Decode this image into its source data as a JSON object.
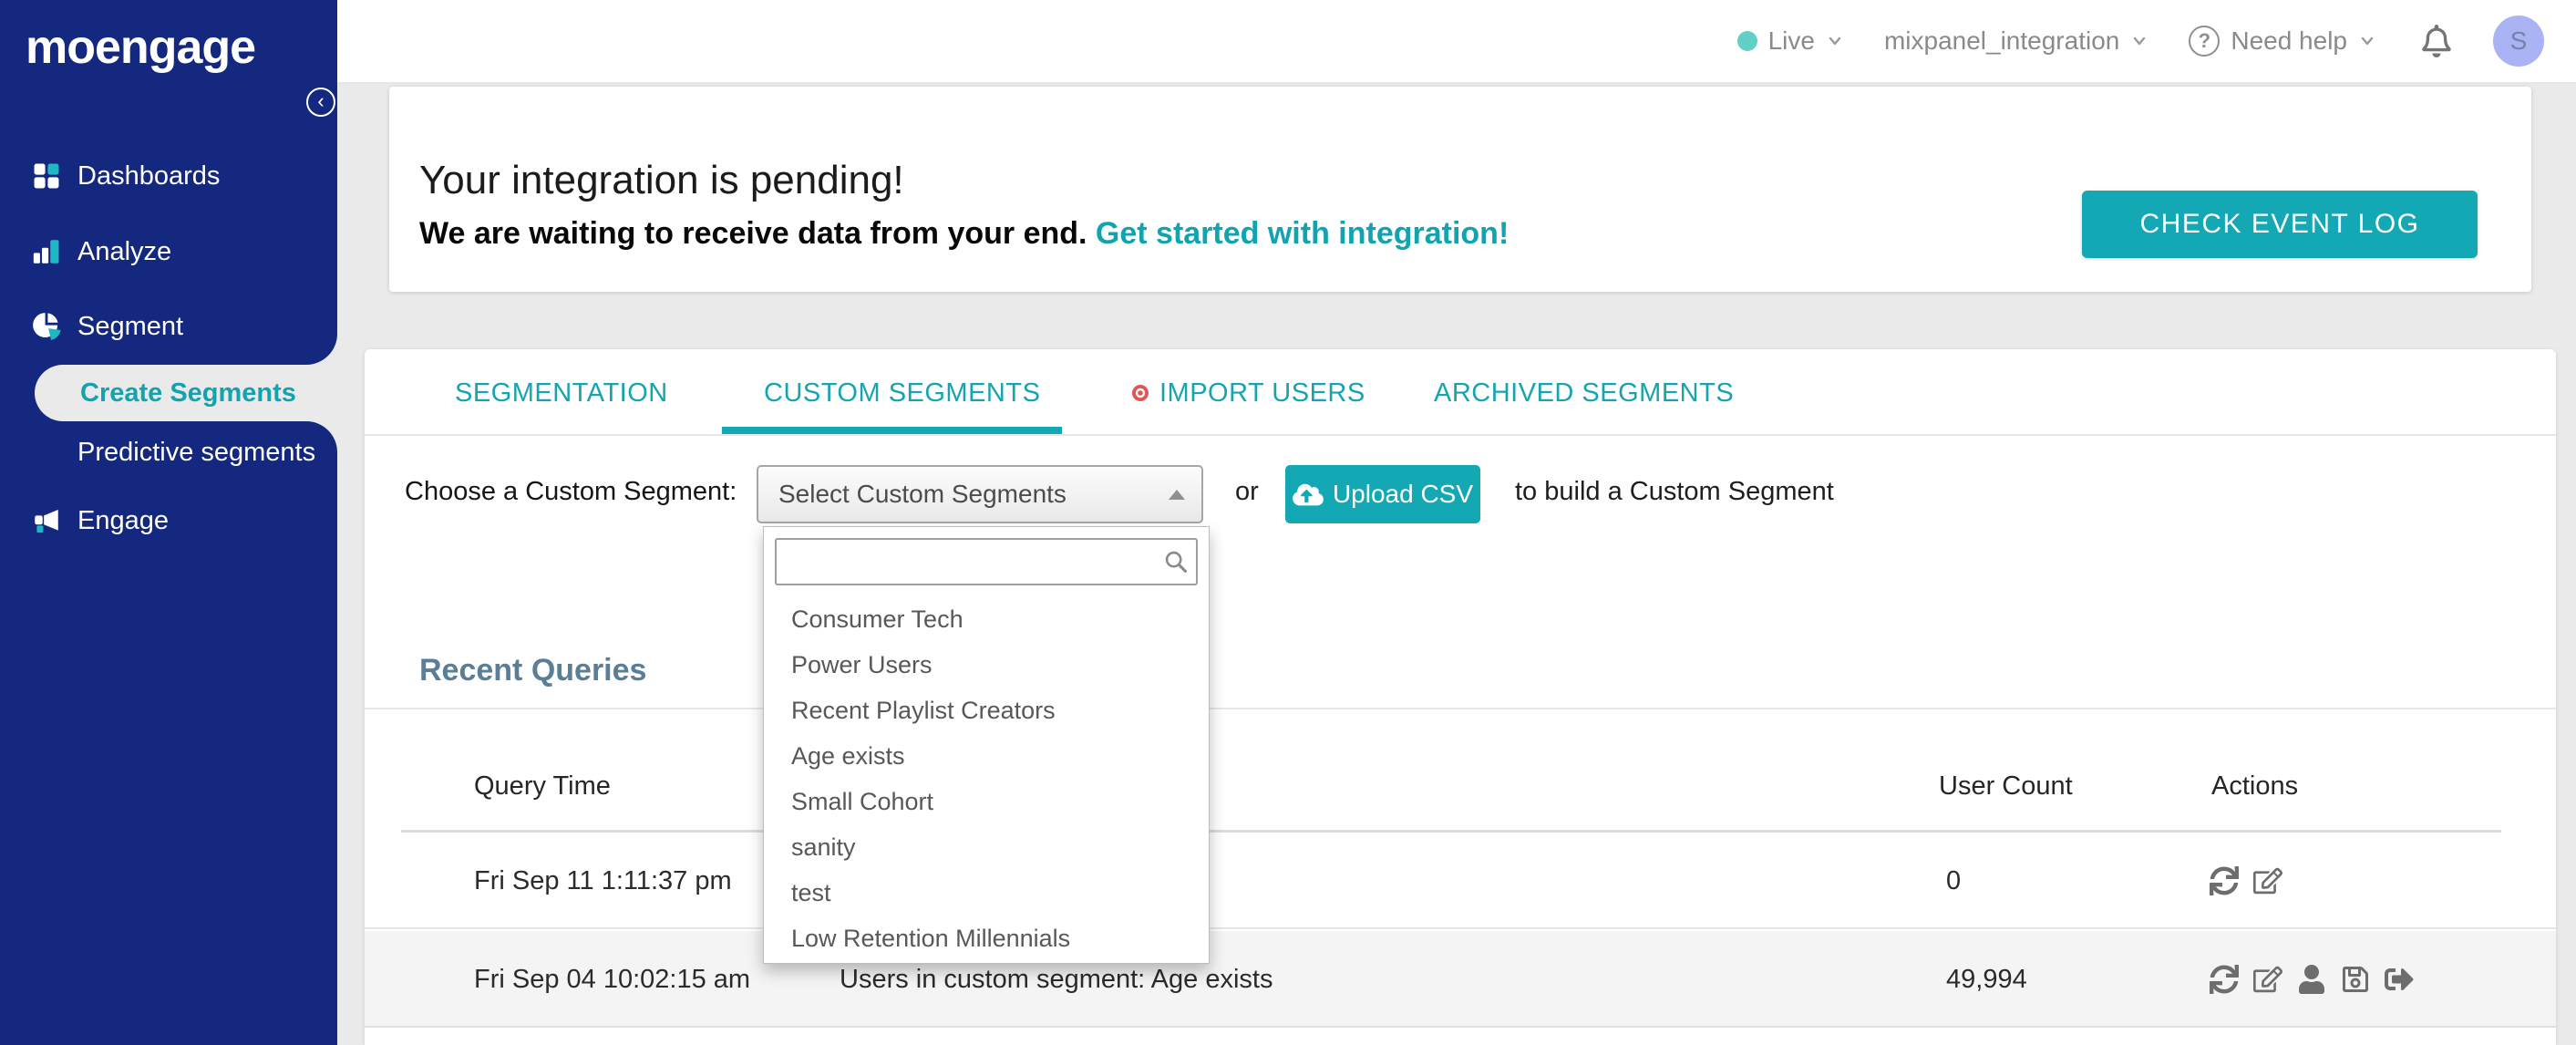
{
  "colors": {
    "navy": "#13287e",
    "teal": "#13a8b4",
    "teal_text": "#16a4b0",
    "page_bg": "#eaeaea",
    "import_dot_red": "#e25555",
    "avatar_bg": "#aab3f4",
    "live_dot": "#63cfc7",
    "heading_slate": "#5a7d98",
    "row_alt_bg": "#f4f4f4"
  },
  "topbar": {
    "env_label": "Live",
    "workspace": "mixpanel_integration",
    "help_label": "Need help",
    "avatar_initial": "S"
  },
  "sidebar": {
    "logo": "moengage",
    "items": [
      "Dashboards",
      "Analyze",
      "Segment"
    ],
    "sub_items": [
      "Create Segments",
      "Predictive segments"
    ],
    "items_after": [
      "Engage"
    ],
    "active_sub_item": "Create Segments",
    "icons": [
      "grid-icon",
      "bar-chart-icon",
      "pie-chart-icon",
      "megaphone-icon",
      "collapse-chevron-icon"
    ]
  },
  "banner": {
    "title": "Your integration is pending!",
    "subtitle": "We are waiting to receive data from your end.",
    "link_label": "Get started with integration!",
    "button_label": "CHECK EVENT LOG"
  },
  "tabs": [
    {
      "label": "SEGMENTATION",
      "active": false
    },
    {
      "label": "CUSTOM SEGMENTS",
      "active": true
    },
    {
      "label": "IMPORT USERS",
      "active": false,
      "has_red_dot": true
    },
    {
      "label": "ARCHIVED SEGMENTS",
      "active": false
    }
  ],
  "segment_picker": {
    "label": "Choose a Custom Segment:",
    "select_value": "Select Custom Segments",
    "or_label": "or",
    "upload_label": "Upload CSV",
    "suffix": "to build a Custom Segment",
    "search_value": "",
    "options": [
      "Consumer Tech",
      "Power Users",
      "Recent Playlist Creators",
      "Age exists",
      "Small Cohort",
      "sanity",
      "test",
      "Low Retention Millennials"
    ]
  },
  "recent_queries": {
    "title": "Recent Queries",
    "columns": {
      "time": "Query Time",
      "count": "User Count",
      "actions": "Actions"
    },
    "rows": [
      {
        "time": "Fri Sep 11 1:11:37 pm",
        "info": "",
        "count": "0",
        "actions": [
          "refresh-icon",
          "edit-icon"
        ]
      },
      {
        "time": "Fri Sep 04 10:02:15 am",
        "info": "Users in custom segment: Age exists",
        "count": "49,994",
        "actions": [
          "refresh-icon",
          "edit-icon",
          "user-icon",
          "save-icon",
          "export-icon"
        ]
      }
    ]
  }
}
